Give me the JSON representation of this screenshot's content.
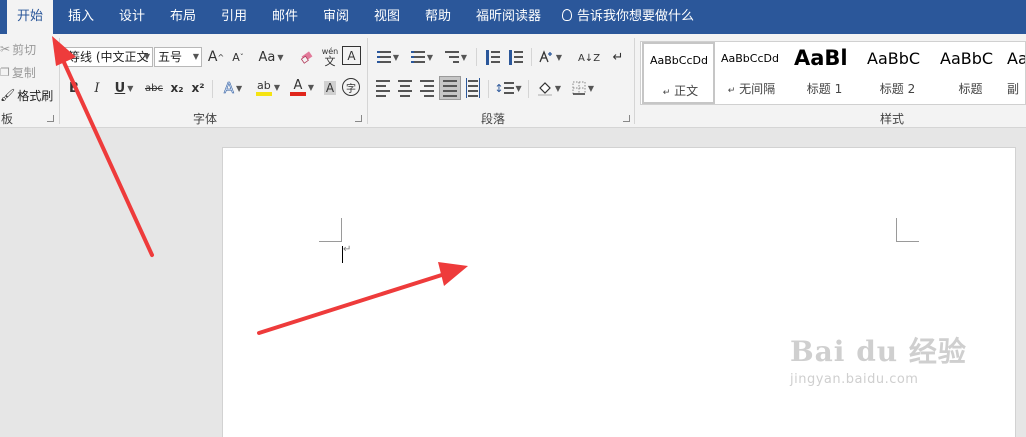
{
  "tabs": [
    {
      "label": "开始",
      "active": true
    },
    {
      "label": "插入"
    },
    {
      "label": "设计"
    },
    {
      "label": "布局"
    },
    {
      "label": "引用"
    },
    {
      "label": "邮件"
    },
    {
      "label": "审阅"
    },
    {
      "label": "视图"
    },
    {
      "label": "帮助"
    },
    {
      "label": "福昕阅读器"
    }
  ],
  "tell_me": "告诉我你想要做什么",
  "clipboard": {
    "cut": "剪切",
    "copy": "复制",
    "format_painter": "格式刷",
    "group_label": "板"
  },
  "font": {
    "font_name": "等线 (中文正文",
    "font_size": "五号",
    "grow": "A",
    "shrink": "A",
    "change_case": "Aa",
    "phonetic_top": "wén",
    "phonetic_bottom": "文",
    "border_char": "A",
    "bold": "B",
    "italic": "I",
    "underline": "U",
    "strike": "abc",
    "subscript": "x₂",
    "superscript": "x²",
    "effects": "A",
    "highlight": "ab",
    "font_color": "A",
    "enclose": "字",
    "group_label": "字体"
  },
  "paragraph": {
    "sort": "A↓Z",
    "group_label": "段落"
  },
  "styles": {
    "items": [
      {
        "preview": "AaBbCcDd",
        "name": "正文",
        "mark": "↵"
      },
      {
        "preview": "AaBbCcDd",
        "name": "无间隔",
        "mark": "↵"
      },
      {
        "preview": "AaBl",
        "name": "标题 1"
      },
      {
        "preview": "AaBbC",
        "name": "标题 2"
      },
      {
        "preview": "AaBbC",
        "name": "标题"
      },
      {
        "preview": "Aa",
        "name": "副"
      }
    ],
    "group_label": "样式"
  },
  "document": {
    "paragraph_mark": "↵"
  },
  "watermark": {
    "logo": "Bai du 经验",
    "url": "jingyan.baidu.com"
  },
  "colors": {
    "tab_bar": "#2b579a",
    "ribbon": "#f3f3f3",
    "annotation_arrow": "#ee3b3b",
    "highlight_yellow": "#f5e312",
    "font_red": "#e0251b"
  }
}
